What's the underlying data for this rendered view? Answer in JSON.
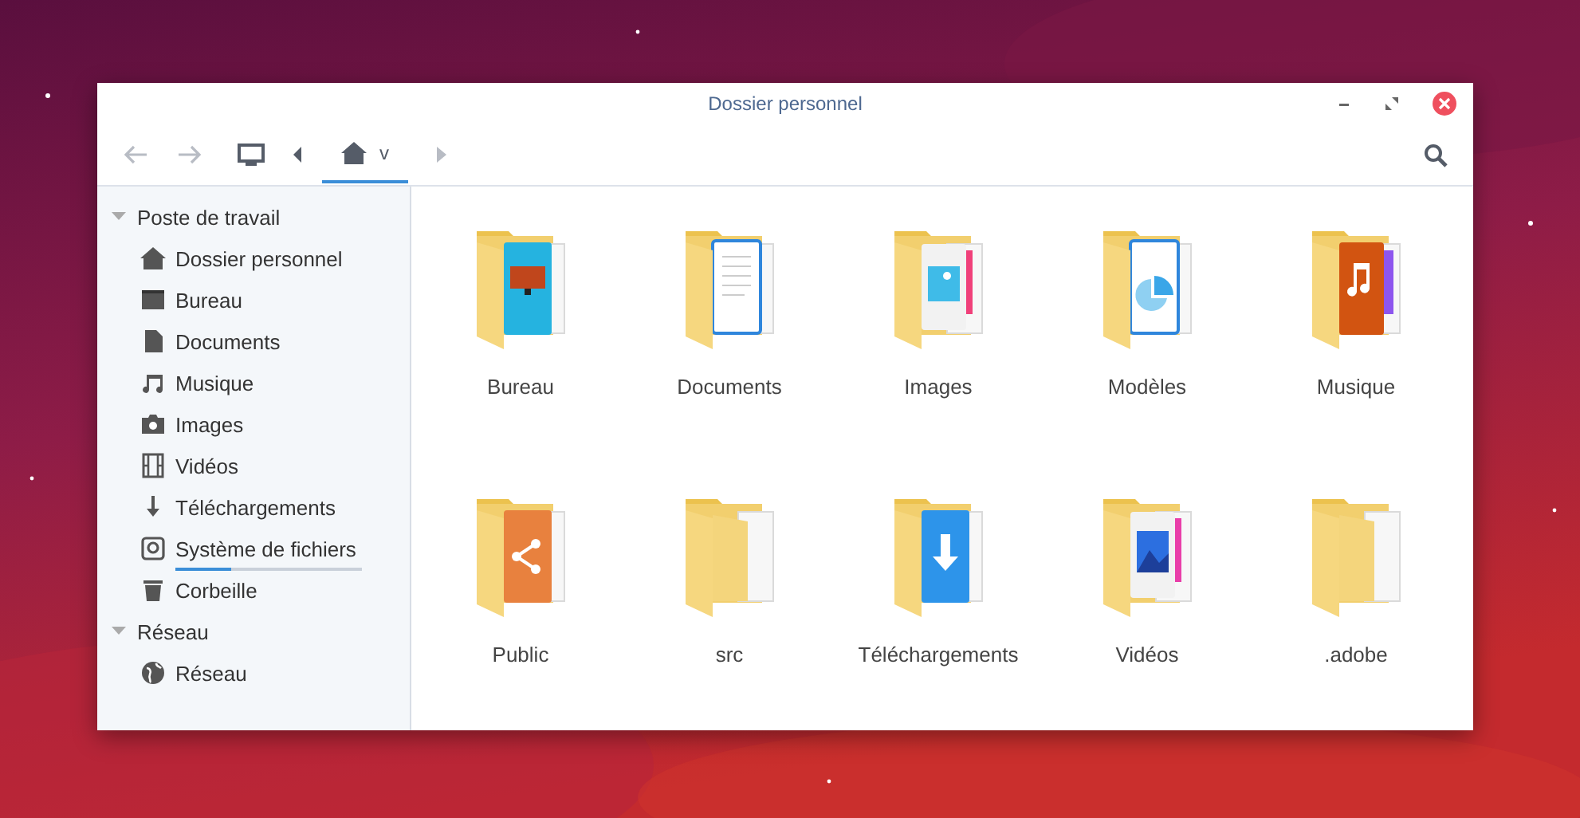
{
  "window": {
    "title": "Dossier personnel"
  },
  "breadcrumb": [
    {
      "label": "v",
      "kind": "home",
      "selected": true
    }
  ],
  "sidebar": [
    {
      "label": "Poste de travail",
      "expanded": true,
      "items": [
        {
          "label": "Dossier personnel",
          "kind": "home"
        },
        {
          "label": "Bureau",
          "kind": "desktop"
        },
        {
          "label": "Documents",
          "kind": "document"
        },
        {
          "label": "Musique",
          "kind": "music"
        },
        {
          "label": "Images",
          "kind": "camera"
        },
        {
          "label": "Vidéos",
          "kind": "film"
        },
        {
          "label": "Téléchargements",
          "kind": "download"
        },
        {
          "label": "Système de fichiers",
          "kind": "disk",
          "level": 0.3
        },
        {
          "label": "Corbeille",
          "kind": "trash"
        }
      ]
    },
    {
      "label": "Réseau",
      "expanded": true,
      "items": [
        {
          "label": "Réseau",
          "kind": "globe"
        }
      ]
    }
  ],
  "files": [
    {
      "name": "Bureau",
      "kind": "desktop"
    },
    {
      "name": "Documents",
      "kind": "documents"
    },
    {
      "name": "Images",
      "kind": "images"
    },
    {
      "name": "Modèles",
      "kind": "templates"
    },
    {
      "name": "Musique",
      "kind": "music"
    },
    {
      "name": "Public",
      "kind": "public"
    },
    {
      "name": "src",
      "kind": "plain"
    },
    {
      "name": "Téléchargements",
      "kind": "downloads"
    },
    {
      "name": "Vidéos",
      "kind": "videos"
    },
    {
      "name": ".adobe",
      "kind": "plain"
    }
  ]
}
